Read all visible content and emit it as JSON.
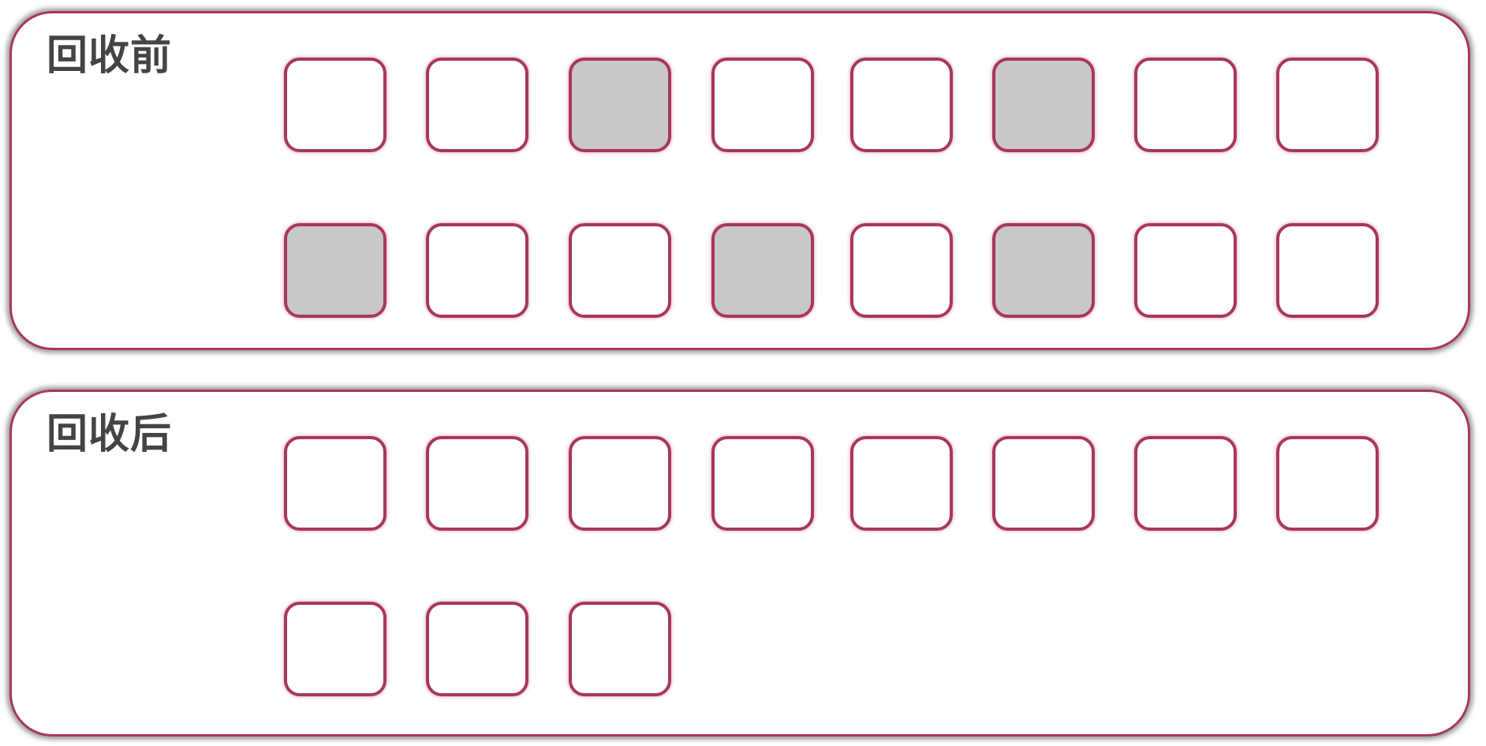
{
  "panels": [
    {
      "id": "before",
      "title": "回收前",
      "rows": [
        [
          "empty",
          "empty",
          "occupied",
          "empty",
          "empty",
          "occupied",
          "empty",
          "empty"
        ],
        [
          "occupied",
          "empty",
          "empty",
          "occupied",
          "empty",
          "occupied",
          "empty",
          "empty"
        ]
      ]
    },
    {
      "id": "after",
      "title": "回收后",
      "rows": [
        [
          "empty",
          "empty",
          "empty",
          "empty",
          "empty",
          "empty",
          "empty",
          "empty"
        ],
        [
          "empty",
          "empty",
          "empty"
        ]
      ]
    }
  ],
  "colors": {
    "border": "#a8385a",
    "occupied_fill": "#c8c8c8",
    "empty_fill": "#ffffff",
    "title_text": "#444444"
  }
}
